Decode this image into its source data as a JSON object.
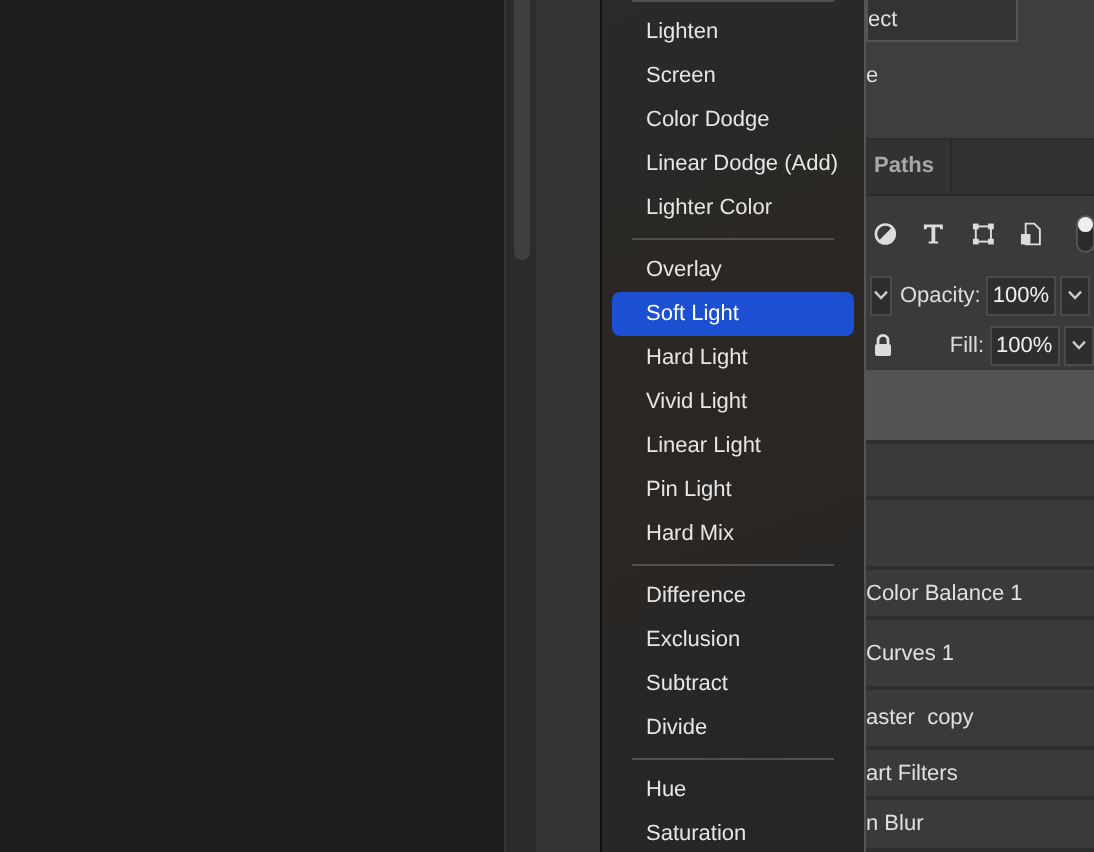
{
  "blend_menu": {
    "groups": [
      {
        "items": [
          {
            "label": "Lighten",
            "selected": false
          },
          {
            "label": "Screen",
            "selected": false
          },
          {
            "label": "Color Dodge",
            "selected": false
          },
          {
            "label": "Linear Dodge (Add)",
            "selected": false
          },
          {
            "label": "Lighter Color",
            "selected": false
          }
        ]
      },
      {
        "items": [
          {
            "label": "Overlay",
            "selected": false
          },
          {
            "label": "Soft Light",
            "selected": true
          },
          {
            "label": "Hard Light",
            "selected": false
          },
          {
            "label": "Vivid Light",
            "selected": false
          },
          {
            "label": "Linear Light",
            "selected": false
          },
          {
            "label": "Pin Light",
            "selected": false
          },
          {
            "label": "Hard Mix",
            "selected": false
          }
        ]
      },
      {
        "items": [
          {
            "label": "Difference",
            "selected": false
          },
          {
            "label": "Exclusion",
            "selected": false
          },
          {
            "label": "Subtract",
            "selected": false
          },
          {
            "label": "Divide",
            "selected": false
          }
        ]
      },
      {
        "items": [
          {
            "label": "Hue",
            "selected": false
          },
          {
            "label": "Saturation",
            "selected": false
          }
        ]
      }
    ]
  },
  "properties": {
    "field_value": "ect",
    "option_label": "e"
  },
  "layer_toggle": {
    "on": true
  },
  "tabs": [
    {
      "label": "Paths",
      "selected": false
    }
  ],
  "layer_controls": {
    "opacity_label": "Opacity:",
    "opacity": "100%",
    "fill_label": "Fill:",
    "fill": "100%"
  },
  "layers": [
    {
      "selected": true
    },
    {
      "selected": false
    },
    {
      "selected": false
    },
    {
      "name": "Color Balance 1",
      "selected": false
    },
    {
      "name": "Curves 1",
      "selected": false
    },
    {
      "name": "aster  copy",
      "selected": false
    },
    {
      "name": "art Filters",
      "selected": false
    },
    {
      "name": "n Blur",
      "selected": false
    }
  ]
}
